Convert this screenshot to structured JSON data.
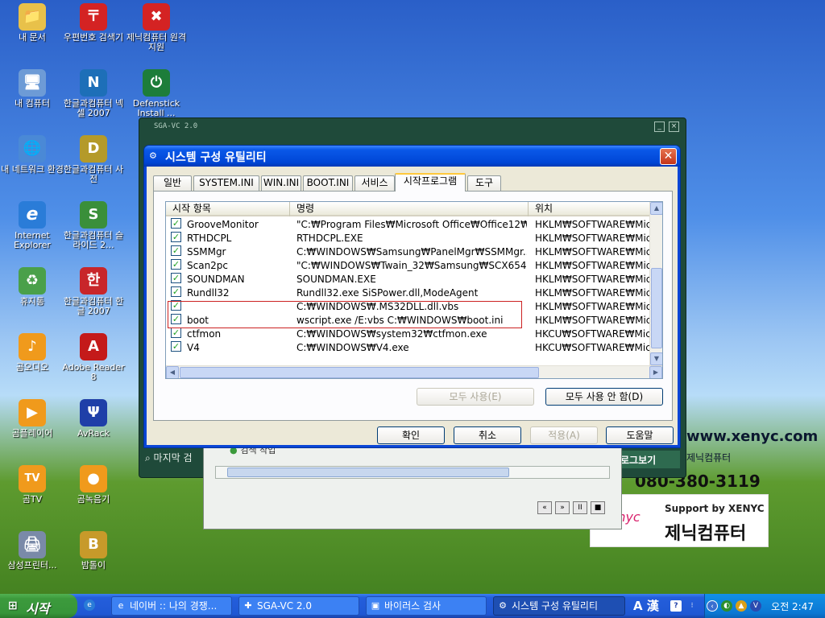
{
  "desktop": {
    "icons": [
      {
        "label": "내 문서",
        "glyph": "📁"
      },
      {
        "label": "우편번호 검색기",
        "glyph": "〒"
      },
      {
        "label": "제닉컴퓨터 원격지원",
        "glyph": "✖"
      },
      {
        "label": "내 컴퓨터",
        "glyph": "🖥"
      },
      {
        "label": "한글과컴퓨터 넥셀 2007",
        "glyph": "N"
      },
      {
        "label": "Defenstick Install ...",
        "glyph": "⏻"
      },
      {
        "label": "내 네트워크 환경",
        "glyph": "🌐"
      },
      {
        "label": "한글과컴퓨터 사전",
        "glyph": "D"
      },
      {
        "label": "Internet Explorer",
        "glyph": "e"
      },
      {
        "label": "한글과컴퓨터 슬라이드 2...",
        "glyph": "S"
      },
      {
        "label": "휴지통",
        "glyph": "♻"
      },
      {
        "label": "한글과컴퓨터 한글 2007",
        "glyph": "한"
      },
      {
        "label": "곰오디오",
        "glyph": "♪"
      },
      {
        "label": "Adobe Reader 8",
        "glyph": "A"
      },
      {
        "label": "곰플레이어",
        "glyph": "▶"
      },
      {
        "label": "AvRack",
        "glyph": "Ψ"
      },
      {
        "label": "곰TV",
        "glyph": "TV"
      },
      {
        "label": "곰녹음기",
        "glyph": "●"
      },
      {
        "label": "삼성프린터...",
        "glyph": "🖨"
      },
      {
        "label": "밤톨이",
        "glyph": "B"
      }
    ]
  },
  "background_window": {
    "title": "SGA-VC 2.0",
    "minimize": "_",
    "close": "×",
    "search_label": "마지막 검",
    "status_text": "검색 작업",
    "log_button": "로그보기",
    "media_controls": [
      "«",
      "»",
      "II",
      "■"
    ]
  },
  "ad": {
    "url": "www.xenyc.com",
    "brand_small": "제닉컴퓨터",
    "phone": "080-380-3119",
    "support": "Support by XENYC",
    "brand_big": "제닉컴퓨터",
    "logo": "xenyc"
  },
  "dialog": {
    "title": "시스템 구성 유틸리티",
    "close_label": "✕",
    "tabs": [
      {
        "label": "일반"
      },
      {
        "label": "SYSTEM.INI"
      },
      {
        "label": "WIN.INI"
      },
      {
        "label": "BOOT.INI"
      },
      {
        "label": "서비스"
      },
      {
        "label": "시작프로그램"
      },
      {
        "label": "도구"
      }
    ],
    "active_tab": "시작프로그램",
    "columns": [
      "시작 항목",
      "명령",
      "위치"
    ],
    "rows": [
      {
        "name": "GrooveMonitor",
        "command": "\"C:₩Program Files₩Microsoft Office₩Office12₩...",
        "location": "HKLM₩SOFTWARE₩Mic",
        "checked": true
      },
      {
        "name": "RTHDCPL",
        "command": "RTHDCPL.EXE",
        "location": "HKLM₩SOFTWARE₩Mic",
        "checked": true
      },
      {
        "name": "SSMMgr",
        "command": "C:₩WINDOWS₩Samsung₩PanelMgr₩SSMMgr....",
        "location": "HKLM₩SOFTWARE₩Mic",
        "checked": true
      },
      {
        "name": "Scan2pc",
        "command": "\"C:₩WINDOWS₩Twain_32₩Samsung₩SCX654....",
        "location": "HKLM₩SOFTWARE₩Mic",
        "checked": true
      },
      {
        "name": "SOUNDMAN",
        "command": "SOUNDMAN.EXE",
        "location": "HKLM₩SOFTWARE₩Mic",
        "checked": true
      },
      {
        "name": "Rundll32",
        "command": "Rundll32.exe SiSPower.dll,ModeAgent",
        "location": "HKLM₩SOFTWARE₩Mic",
        "checked": true
      },
      {
        "name": "",
        "command": "C:₩WINDOWS₩.MS32DLL.dll.vbs",
        "location": "HKLM₩SOFTWARE₩Mic",
        "checked": true
      },
      {
        "name": "boot",
        "command": "wscript.exe /E:vbs C:₩WINDOWS₩boot.ini",
        "location": "HKLM₩SOFTWARE₩Mic",
        "checked": true
      },
      {
        "name": "ctfmon",
        "command": "C:₩WINDOWS₩system32₩ctfmon.exe",
        "location": "HKCU₩SOFTWARE₩Mic",
        "checked": true
      },
      {
        "name": "V4",
        "command": "C:₩WINDOWS₩V4.exe",
        "location": "HKCU₩SOFTWARE₩Mic",
        "checked": true
      }
    ],
    "enable_all": "모두 사용(E)",
    "disable_all": "모두 사용 안 함(D)",
    "ok": "확인",
    "cancel": "취소",
    "apply": "적용(A)",
    "help": "도움말"
  },
  "taskbar": {
    "start_label": "시작",
    "tasks": [
      {
        "label": "네이버 :: 나의 경쟁...",
        "icon": "e"
      },
      {
        "label": "SGA-VC 2.0",
        "icon": "✚"
      },
      {
        "label": "바이러스 검사",
        "icon": "▣"
      },
      {
        "label": "시스템 구성 유틸리티",
        "icon": "⚙"
      }
    ],
    "lang_bar": "A 漢",
    "clock": "오전 2:47"
  }
}
